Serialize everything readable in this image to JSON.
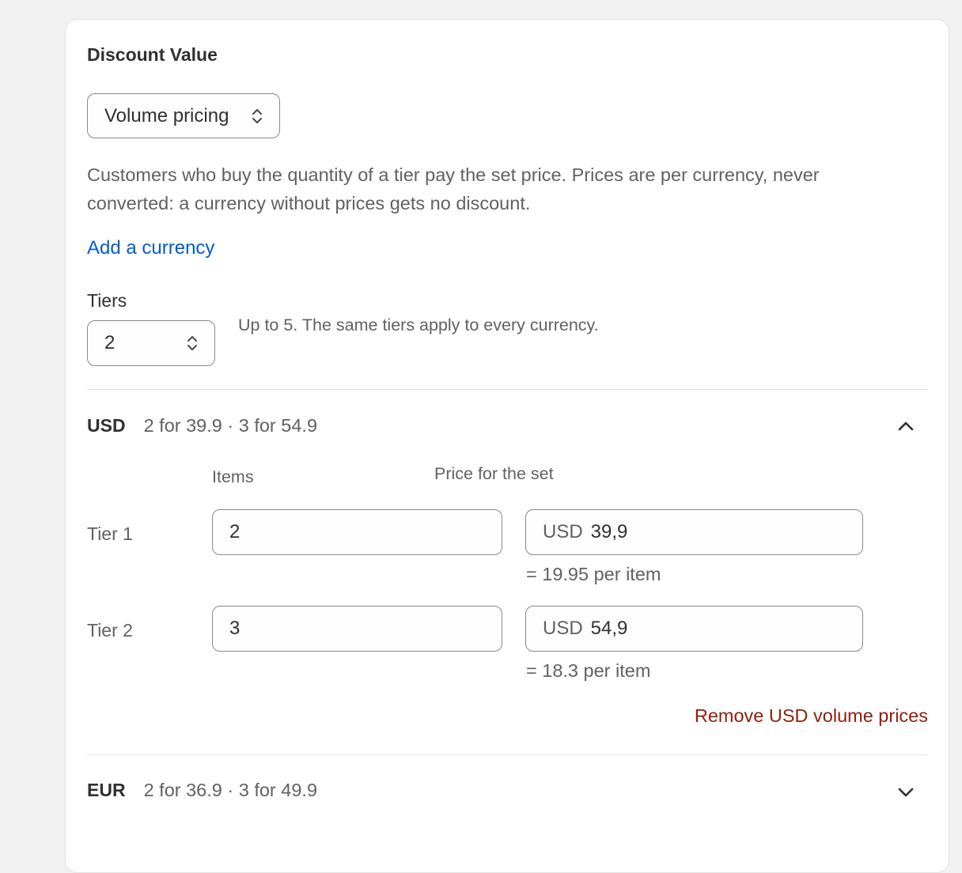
{
  "section": {
    "title": "Discount Value",
    "discount_type": "Volume pricing",
    "description": "Customers who buy the quantity of a tier pay the set price. Prices are per currency, never converted: a currency without prices gets no discount.",
    "add_currency_label": "Add a currency",
    "tiers_label": "Tiers",
    "tiers_value": "2",
    "tiers_help": "Up to 5. The same tiers apply to every currency."
  },
  "usd": {
    "code": "USD",
    "summary": "2 for 39.9 · 3 for 54.9",
    "expanded": true,
    "items_header": "Items",
    "price_header": "Price for the set",
    "tiers": [
      {
        "label": "Tier 1",
        "items": "2",
        "currency_prefix": "USD",
        "price": "39,9",
        "per_item": "= 19.95 per item"
      },
      {
        "label": "Tier 2",
        "items": "3",
        "currency_prefix": "USD",
        "price": "54,9",
        "per_item": "= 18.3 per item"
      }
    ],
    "remove_label": "Remove USD volume prices"
  },
  "eur": {
    "code": "EUR",
    "summary": "2 for 36.9 · 3 for 49.9",
    "expanded": false
  },
  "icons": {
    "select_chevron": "up-down-chevron-icon",
    "collapse": "chevron-up-icon",
    "expand": "chevron-down-icon"
  },
  "colors": {
    "link": "#005bd3",
    "destructive": "#8e1f0b",
    "text": "#303030",
    "subdued": "#616161",
    "background": "#f1f1f1"
  }
}
